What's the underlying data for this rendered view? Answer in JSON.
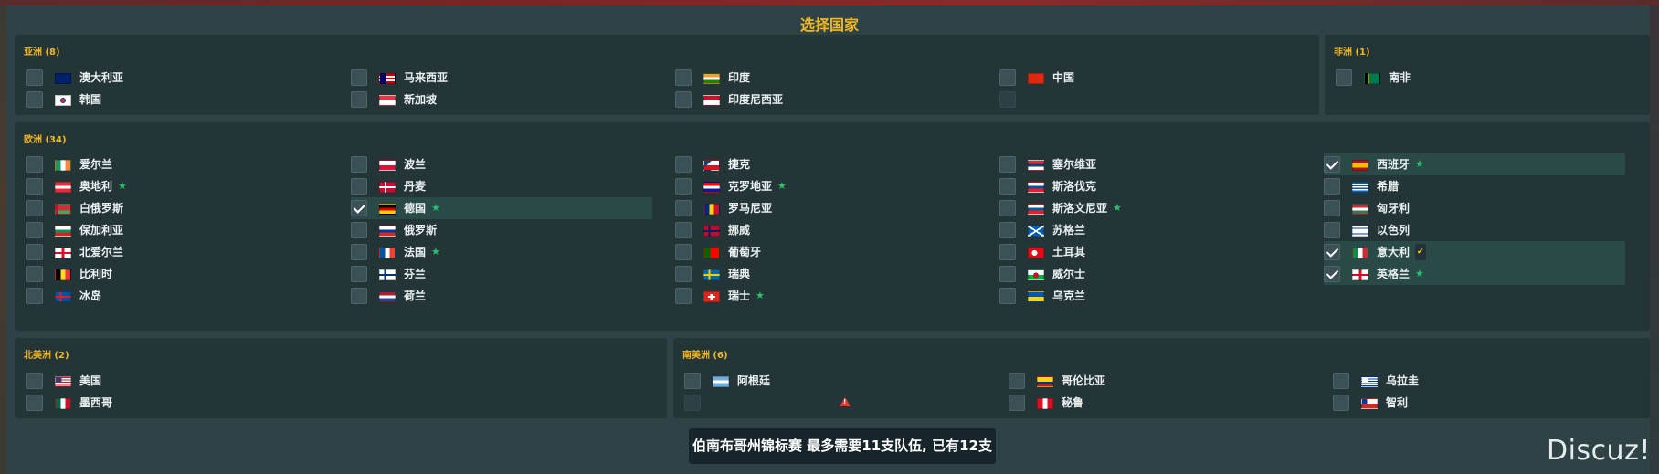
{
  "title": "选择国家",
  "status_message": "伯南布哥州锦标赛 最多需要11支队伍, 已有12支",
  "watermark": "Discuz!",
  "colors": {
    "accent": "#f2b824",
    "star": "#27c26a",
    "warning": "#e23b2e",
    "selected_row": "#2a4a48"
  },
  "asia": {
    "title": "亚洲 (8)",
    "items": [
      {
        "name": "澳大利亚",
        "flag": "flag-australia",
        "checked": false
      },
      {
        "name": "马来西亚",
        "flag": "flag-malaysia",
        "checked": false
      },
      {
        "name": "印度",
        "flag": "flag-india",
        "checked": false
      },
      {
        "name": "中国",
        "flag": "flag-china",
        "checked": false
      },
      {
        "name": "韩国",
        "flag": "flag-south-korea",
        "checked": false
      },
      {
        "name": "新加坡",
        "flag": "flag-singapore",
        "checked": false
      },
      {
        "name": "印度尼西亚",
        "flag": "flag-indonesia",
        "checked": false
      },
      {
        "name": "",
        "flag": "",
        "checked": false,
        "disabled": true,
        "warning": "warning-icon"
      }
    ]
  },
  "africa": {
    "title": "非洲 (1)",
    "items": [
      {
        "name": "南非",
        "flag": "flag-south-africa",
        "checked": false
      }
    ]
  },
  "europe": {
    "title": "欧洲 (34)",
    "items": [
      {
        "name": "爱尔兰",
        "flag": "flag-ireland",
        "checked": false
      },
      {
        "name": "波兰",
        "flag": "flag-poland",
        "checked": false
      },
      {
        "name": "捷克",
        "flag": "flag-czech",
        "checked": false
      },
      {
        "name": "塞尔维亚",
        "flag": "flag-serbia",
        "checked": false
      },
      {
        "name": "西班牙",
        "flag": "flag-spain",
        "checked": true,
        "badge": "star"
      },
      {
        "name": "奥地利",
        "flag": "flag-austria",
        "checked": false,
        "badge": "star"
      },
      {
        "name": "丹麦",
        "flag": "flag-denmark",
        "checked": false
      },
      {
        "name": "克罗地亚",
        "flag": "flag-croatia",
        "checked": false,
        "badge": "star"
      },
      {
        "name": "斯洛伐克",
        "flag": "flag-slovakia",
        "checked": false
      },
      {
        "name": "希腊",
        "flag": "flag-greece",
        "checked": false
      },
      {
        "name": "白俄罗斯",
        "flag": "flag-belarus",
        "checked": false
      },
      {
        "name": "德国",
        "flag": "flag-germany",
        "checked": true,
        "badge": "star"
      },
      {
        "name": "罗马尼亚",
        "flag": "flag-romania",
        "checked": false
      },
      {
        "name": "斯洛文尼亚",
        "flag": "flag-slovenia",
        "checked": false,
        "badge": "star"
      },
      {
        "name": "匈牙利",
        "flag": "flag-hungary",
        "checked": false
      },
      {
        "name": "保加利亚",
        "flag": "flag-bulgaria",
        "checked": false
      },
      {
        "name": "俄罗斯",
        "flag": "flag-russia",
        "checked": false
      },
      {
        "name": "挪威",
        "flag": "flag-norway",
        "checked": false
      },
      {
        "name": "苏格兰",
        "flag": "flag-scotland",
        "checked": false
      },
      {
        "name": "以色列",
        "flag": "flag-israel",
        "checked": false
      },
      {
        "name": "北爱尔兰",
        "flag": "flag-northern-ireland",
        "checked": false
      },
      {
        "name": "法国",
        "flag": "flag-france",
        "checked": false,
        "badge": "star"
      },
      {
        "name": "葡萄牙",
        "flag": "flag-portugal",
        "checked": false
      },
      {
        "name": "土耳其",
        "flag": "flag-turkey",
        "checked": false
      },
      {
        "name": "意大利",
        "flag": "flag-italy",
        "checked": true,
        "badge": "tick"
      },
      {
        "name": "比利时",
        "flag": "flag-belgium",
        "checked": false
      },
      {
        "name": "芬兰",
        "flag": "flag-finland",
        "checked": false
      },
      {
        "name": "瑞典",
        "flag": "flag-sweden",
        "checked": false
      },
      {
        "name": "威尔士",
        "flag": "flag-wales",
        "checked": false
      },
      {
        "name": "英格兰",
        "flag": "flag-england",
        "checked": true,
        "badge": "star"
      },
      {
        "name": "冰岛",
        "flag": "flag-iceland",
        "checked": false
      },
      {
        "name": "荷兰",
        "flag": "flag-netherlands",
        "checked": false
      },
      {
        "name": "瑞士",
        "flag": "flag-switzerland",
        "checked": false,
        "badge": "star"
      },
      {
        "name": "乌克兰",
        "flag": "flag-ukraine",
        "checked": false
      }
    ]
  },
  "north_america": {
    "title": "北美洲 (2)",
    "items": [
      {
        "name": "美国",
        "flag": "flag-usa",
        "checked": false
      },
      {
        "name": "墨西哥",
        "flag": "flag-mexico",
        "checked": false
      }
    ]
  },
  "south_america": {
    "title": "南美洲 (6)",
    "items": [
      {
        "name": "阿根廷",
        "flag": "flag-argentina",
        "checked": false
      },
      {
        "name": "哥伦比亚",
        "flag": "flag-colombia",
        "checked": false
      },
      {
        "name": "乌拉圭",
        "flag": "flag-uruguay",
        "checked": false
      },
      {
        "name": "",
        "flag": "",
        "checked": false,
        "disabled": true,
        "warning": "warning-icon"
      },
      {
        "name": "秘鲁",
        "flag": "flag-peru",
        "checked": false
      },
      {
        "name": "智利",
        "flag": "flag-chile",
        "checked": false
      }
    ]
  }
}
